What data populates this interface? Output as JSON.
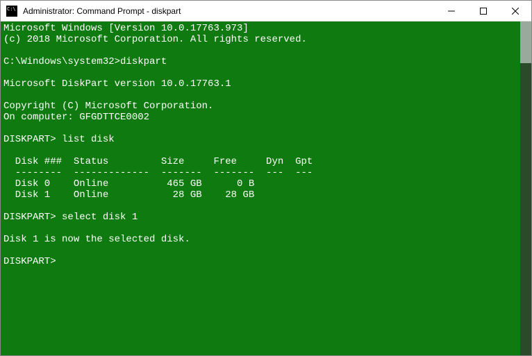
{
  "window": {
    "title": "Administrator: Command Prompt - diskpart"
  },
  "terminal": {
    "lines": [
      "Microsoft Windows [Version 10.0.17763.973]",
      "(c) 2018 Microsoft Corporation. All rights reserved.",
      "",
      "C:\\Windows\\system32>diskpart",
      "",
      "Microsoft DiskPart version 10.0.17763.1",
      "",
      "Copyright (C) Microsoft Corporation.",
      "On computer: GFGDTTCE0002",
      "",
      "DISKPART> list disk",
      "",
      "  Disk ###  Status         Size     Free     Dyn  Gpt",
      "  --------  -------------  -------  -------  ---  ---",
      "  Disk 0    Online          465 GB      0 B",
      "  Disk 1    Online           28 GB    28 GB",
      "",
      "DISKPART> select disk 1",
      "",
      "Disk 1 is now the selected disk.",
      "",
      "DISKPART>"
    ]
  }
}
